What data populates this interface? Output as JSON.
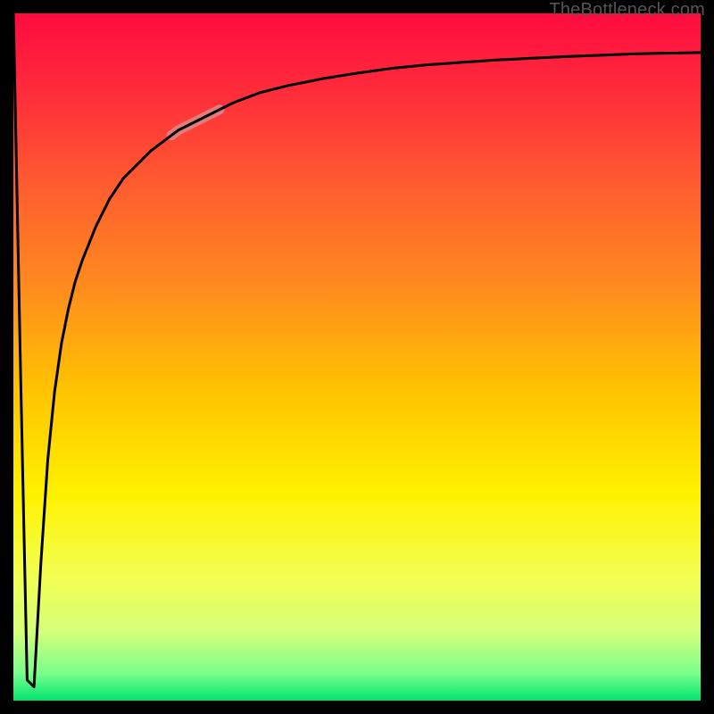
{
  "watermark": "TheBottleneck.com",
  "chart_data": {
    "type": "line",
    "title": "",
    "xlabel": "",
    "ylabel": "",
    "xlim": [
      0,
      100
    ],
    "ylim": [
      0,
      100
    ],
    "x": [
      0,
      1,
      2,
      3,
      4,
      5,
      6,
      7,
      8,
      9,
      10,
      12,
      14,
      16,
      18,
      20,
      24,
      28,
      32,
      36,
      40,
      45,
      50,
      55,
      60,
      70,
      80,
      90,
      100
    ],
    "values": [
      100,
      50,
      3,
      2,
      20,
      35,
      45,
      52,
      57,
      61,
      64,
      69,
      73,
      76,
      78,
      80,
      83,
      85,
      87,
      88.5,
      89.5,
      90.5,
      91.3,
      92,
      92.5,
      93.2,
      93.7,
      94.1,
      94.3
    ],
    "gradient_stops": [
      {
        "offset": 0.0,
        "color": "#ff0b3f"
      },
      {
        "offset": 0.12,
        "color": "#ff2e3a"
      },
      {
        "offset": 0.25,
        "color": "#ff5c2f"
      },
      {
        "offset": 0.4,
        "color": "#ff8c1e"
      },
      {
        "offset": 0.55,
        "color": "#ffc400"
      },
      {
        "offset": 0.7,
        "color": "#fff200"
      },
      {
        "offset": 0.82,
        "color": "#f3ff52"
      },
      {
        "offset": 0.9,
        "color": "#d4ff7a"
      },
      {
        "offset": 0.96,
        "color": "#7aff8c"
      },
      {
        "offset": 1.0,
        "color": "#00e46e"
      }
    ],
    "highlight_segment": {
      "x_start": 23,
      "x_end": 30,
      "color": "#d98a8a",
      "width": 11
    }
  }
}
